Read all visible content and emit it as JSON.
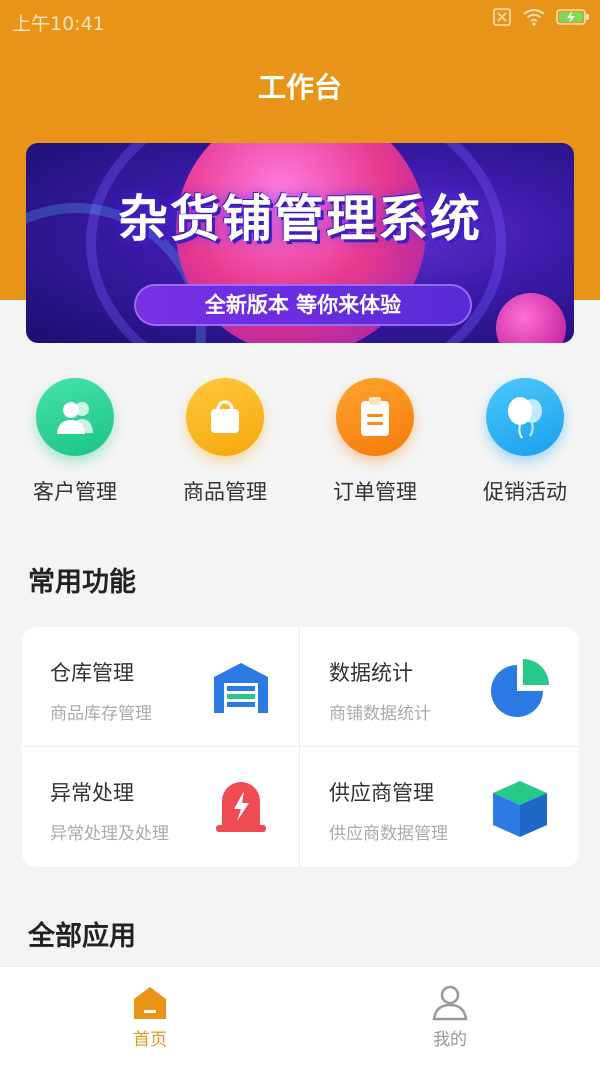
{
  "status_bar": {
    "time": "上午10:41"
  },
  "header": {
    "title": "工作台"
  },
  "banner": {
    "title": "杂货铺管理系统",
    "subtitle": "全新版本 等你来体验"
  },
  "quick_actions": [
    {
      "label": "客户管理",
      "icon": "customers-icon",
      "color": "#2fd59a"
    },
    {
      "label": "商品管理",
      "icon": "shopping-bag-icon",
      "color": "#f8b21a"
    },
    {
      "label": "订单管理",
      "icon": "clipboard-icon",
      "color": "#fb8a12"
    },
    {
      "label": "促销活动",
      "icon": "balloon-icon",
      "color": "#2bb6f3"
    }
  ],
  "sections": {
    "common": "常用功能",
    "all_apps": "全部应用"
  },
  "common_features": [
    {
      "title": "仓库管理",
      "subtitle": "商品库存管理",
      "icon": "warehouse-icon"
    },
    {
      "title": "数据统计",
      "subtitle": "商铺数据统计",
      "icon": "pie-chart-icon"
    },
    {
      "title": "异常处理",
      "subtitle": "异常处理及处理",
      "icon": "alarm-icon"
    },
    {
      "title": "供应商管理",
      "subtitle": "供应商数据管理",
      "icon": "box-icon"
    }
  ],
  "tabbar": [
    {
      "label": "首页",
      "icon": "home-icon",
      "active": true
    },
    {
      "label": "我的",
      "icon": "user-icon",
      "active": false
    }
  ],
  "colors": {
    "brand": "#e89419",
    "active_tab": "#e89419",
    "inactive_tab": "#999999"
  }
}
